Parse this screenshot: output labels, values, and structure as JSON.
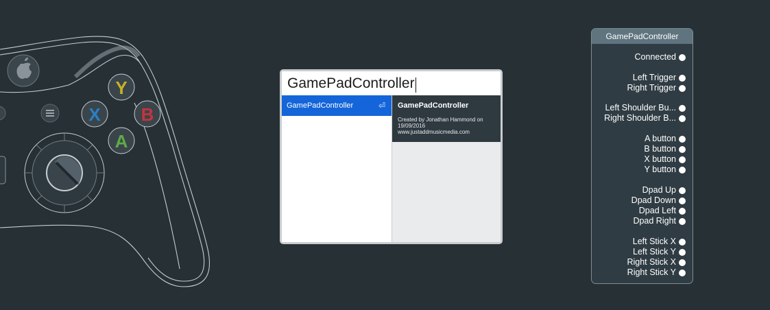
{
  "controller": {
    "buttons": [
      {
        "label": "Y",
        "color": "#c9b223"
      },
      {
        "label": "X",
        "color": "#2b7fc7"
      },
      {
        "label": "B",
        "color": "#c5343c"
      },
      {
        "label": "A",
        "color": "#5faa45"
      }
    ]
  },
  "search": {
    "value": "GamePadController"
  },
  "results": {
    "items": [
      "GamePadController"
    ]
  },
  "details": {
    "title": "GamePadController",
    "description_line1": "Created by Jonathan Hammond on",
    "description_line2": "19/09/2016",
    "description_line3": "www.justaddmusicmedia.com"
  },
  "node": {
    "title": "GamePadController",
    "outputs": [
      "Connected",
      "Left Trigger",
      "Right Trigger",
      "Left Shoulder Bu...",
      "Right Shoulder B...",
      "A button",
      "B button",
      "X button",
      "Y button",
      "Dpad Up",
      "Dpad Down",
      "Dpad Left",
      "Dpad Right",
      "Left Stick X",
      "Left Stick Y",
      "Right Stick X",
      "Right Stick Y"
    ]
  },
  "colors": {
    "background": "#263035",
    "selection": "#1465d9",
    "node_header": "#5f747f"
  }
}
